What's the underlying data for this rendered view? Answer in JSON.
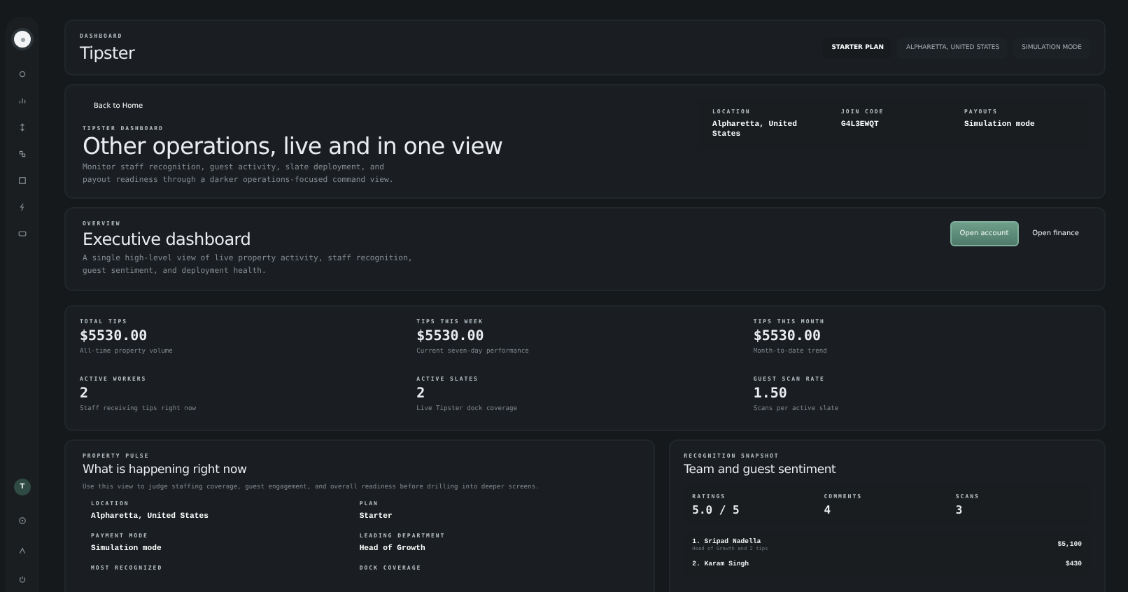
{
  "sidebar": {
    "avatar": "T"
  },
  "header": {
    "eyebrow": "DASHBOARD",
    "title": "Tipster",
    "pills": [
      {
        "label": "STARTER PLAN",
        "selected": true
      },
      {
        "label": "ALPHARETTA, UNITED STATES",
        "selected": false
      },
      {
        "label": "SIMULATION MODE",
        "selected": false
      }
    ]
  },
  "hero": {
    "back_link": "Back to Home",
    "eyebrow": "TIPSTER DASHBOARD",
    "title": "Other operations, live and in one view",
    "description": "Monitor staff recognition, guest activity, slate deployment, and payout readiness through a darker operations-focused command view.",
    "facts": [
      {
        "label": "LOCATION",
        "value": "Alpharetta, United States"
      },
      {
        "label": "JOIN CODE",
        "value": "G4L3EWQT"
      },
      {
        "label": "PAYOUTS",
        "value": "Simulation mode"
      }
    ]
  },
  "overview": {
    "eyebrow": "OVERVIEW",
    "title": "Executive dashboard",
    "description": "A single high-level view of live property activity, staff recognition, guest sentiment, and deployment health.",
    "buttons": [
      {
        "label": "Open account",
        "kind": "primary"
      },
      {
        "label": "Open finance",
        "kind": "plain"
      }
    ]
  },
  "stats": [
    {
      "label": "TOTAL TIPS",
      "value": "$5530.00",
      "caption": "All-time property volume"
    },
    {
      "label": "TIPS THIS WEEK",
      "value": "$5530.00",
      "caption": "Current seven-day performance"
    },
    {
      "label": "TIPS THIS MONTH",
      "value": "$5530.00",
      "caption": "Month-to-date trend"
    },
    {
      "label": "ACTIVE WORKERS",
      "value": "2",
      "caption": "Staff receiving tips right now"
    },
    {
      "label": "ACTIVE SLATES",
      "value": "2",
      "caption": "Live Tipster dock coverage"
    },
    {
      "label": "GUEST SCAN RATE",
      "value": "1.50",
      "caption": "Scans per active slate"
    }
  ],
  "property_pulse": {
    "eyebrow": "PROPERTY PULSE",
    "title": "What is happening right now",
    "description": "Use this view to judge staffing coverage, guest engagement, and overall readiness before drilling into deeper screens.",
    "fields": [
      {
        "label": "LOCATION",
        "value": "Alpharetta, United States"
      },
      {
        "label": "PLAN",
        "value": "Starter"
      },
      {
        "label": "PAYMENT MODE",
        "value": "Simulation mode"
      },
      {
        "label": "LEADING DEPARTMENT",
        "value": "Head of Growth"
      },
      {
        "label": "MOST RECOGNIZED"
      },
      {
        "label": "DOCK COVERAGE"
      }
    ]
  },
  "recognition": {
    "eyebrow": "RECOGNITION SNAPSHOT",
    "title": "Team and guest sentiment",
    "metrics": [
      {
        "label": "RATINGS",
        "value": "5.0 / 5"
      },
      {
        "label": "COMMENTS",
        "value": "4"
      },
      {
        "label": "SCANS",
        "value": "3"
      }
    ],
    "leaders": [
      {
        "name": "1. Sripad Nadella",
        "detail": "Head of Growth and 2 tips",
        "amount": "$5,100"
      },
      {
        "name": "2. Karam Singh",
        "amount": "$430"
      }
    ]
  }
}
